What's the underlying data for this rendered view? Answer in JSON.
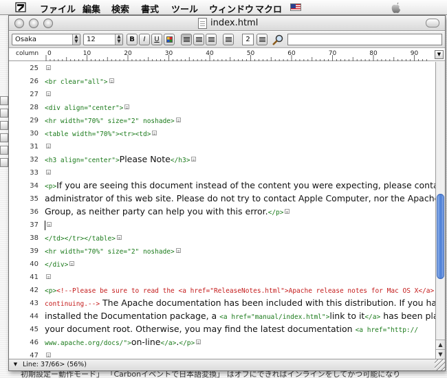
{
  "menubar": {
    "items": [
      "ファイル",
      "編集",
      "検索",
      "書式",
      "ツール",
      "ウィンドウ",
      "マクロ"
    ]
  },
  "window": {
    "title": "index.html"
  },
  "toolbar": {
    "font": "Osaka",
    "size": "12",
    "bold": "B",
    "italic": "I",
    "underline": "U",
    "line_spacing": "2",
    "find_text": ""
  },
  "ruler": {
    "label": "column",
    "ticks": [
      "0",
      "10",
      "20",
      "30",
      "40",
      "50",
      "60",
      "70",
      "80",
      "90"
    ]
  },
  "editor": {
    "lines": [
      {
        "n": "25",
        "segs": []
      },
      {
        "n": "26",
        "segs": [
          {
            "t": "tag",
            "v": "<br clear=\"all\">"
          }
        ]
      },
      {
        "n": "27",
        "segs": []
      },
      {
        "n": "28",
        "segs": [
          {
            "t": "tag",
            "v": "<div align=\"center\">"
          }
        ]
      },
      {
        "n": "29",
        "segs": [
          {
            "t": "tag",
            "v": "<hr width=\"70%\" size=\"2\" noshade>"
          }
        ]
      },
      {
        "n": "30",
        "segs": [
          {
            "t": "tag",
            "v": "<table width=\"70%\"><tr><td>"
          }
        ]
      },
      {
        "n": "31",
        "segs": []
      },
      {
        "n": "32",
        "segs": [
          {
            "t": "tag",
            "v": "<h3 align=\"center\">"
          },
          {
            "t": "txt",
            "v": "Please Note"
          },
          {
            "t": "tag",
            "v": "</h3>"
          }
        ]
      },
      {
        "n": "33",
        "segs": []
      },
      {
        "n": "34",
        "segs": [
          {
            "t": "tag",
            "v": "<p>"
          },
          {
            "t": "txt",
            "v": "If you are seeing this document instead of the content you were expecting, please contact the"
          }
        ],
        "noeol": true
      },
      {
        "n": "35",
        "segs": [
          {
            "t": "txt",
            "v": "administrator of this web site. Please do not try to contact Apple Computer, nor the Apache"
          }
        ],
        "noeol": true
      },
      {
        "n": "36",
        "segs": [
          {
            "t": "txt",
            "v": "Group, as neither party can help you with this error."
          },
          {
            "t": "tag",
            "v": "</p>"
          }
        ]
      },
      {
        "n": "37",
        "segs": [],
        "cursor": true
      },
      {
        "n": "38",
        "segs": [
          {
            "t": "tag",
            "v": "</td></tr></table>"
          }
        ]
      },
      {
        "n": "39",
        "segs": [
          {
            "t": "tag",
            "v": "<hr width=\"70%\" size=\"2\" noshade>"
          }
        ]
      },
      {
        "n": "40",
        "segs": [
          {
            "t": "tag",
            "v": "</div>"
          }
        ]
      },
      {
        "n": "41",
        "segs": []
      },
      {
        "n": "42",
        "segs": [
          {
            "t": "tag",
            "v": "<p>"
          },
          {
            "t": "cmt",
            "v": "<!--Please be sure to read the <a href=\"ReleaseNotes.html\">Apache release notes for Mac OS X</a> before"
          }
        ],
        "noeol": true
      },
      {
        "n": "43",
        "segs": [
          {
            "t": "cmt",
            "v": "continuing.-->"
          },
          {
            "t": "txt",
            "v": " The Apache documentation has been included with this distribution. If you have"
          }
        ],
        "noeol": true
      },
      {
        "n": "44",
        "segs": [
          {
            "t": "txt",
            "v": "installed the Documentation package, a "
          },
          {
            "t": "tag",
            "v": "<a href=\"manual/index.html\">"
          },
          {
            "t": "txt",
            "v": "link to it"
          },
          {
            "t": "tag",
            "v": "</a>"
          },
          {
            "t": "txt",
            "v": " has been placed in"
          }
        ],
        "noeol": true
      },
      {
        "n": "45",
        "segs": [
          {
            "t": "txt",
            "v": "your document root. Otherwise, you may find the latest documentation "
          },
          {
            "t": "tag",
            "v": "<a href=\"http://"
          }
        ],
        "noeol": true
      },
      {
        "n": "46",
        "segs": [
          {
            "t": "tag",
            "v": "www.apache.org/docs/\">"
          },
          {
            "t": "txt",
            "v": "on-line"
          },
          {
            "t": "tag",
            "v": "</a>"
          },
          {
            "t": "txt",
            "v": "."
          },
          {
            "t": "tag",
            "v": "</p>"
          }
        ]
      },
      {
        "n": "47",
        "segs": []
      }
    ]
  },
  "status": {
    "text": "Line: 37/66> (56%)"
  },
  "background_window": {
    "text": "初期設定ー動作モード」 「Carbonイベントで日本語変換」 はオフにできればインラインをしてかつ可能になり"
  }
}
